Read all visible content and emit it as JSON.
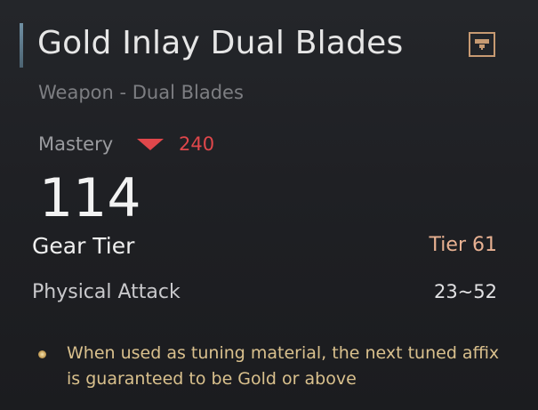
{
  "item": {
    "name": "Gold Inlay Dual Blades",
    "type": "Weapon - Dual Blades",
    "lock_icon": "lock-icon"
  },
  "mastery": {
    "label": "Mastery",
    "change_icon": "down-arrow-icon",
    "change_value": "240",
    "value": "114"
  },
  "gear_tier": {
    "label": "Gear Tier",
    "value": "Tier 61"
  },
  "stats": {
    "physical_attack": {
      "label": "Physical Attack",
      "value": "23~52"
    }
  },
  "effect": {
    "bullet_icon": "gold-dot-icon",
    "text": "When used as tuning material, the next tuned affix is guaranteed to be Gold or above"
  },
  "colors": {
    "background": "#1c1d20",
    "title": "#e6e6e6",
    "decrease": "#e0474b",
    "tier": "#e8b192",
    "effect": "#d9c08d",
    "lock_border": "#c79a72"
  }
}
